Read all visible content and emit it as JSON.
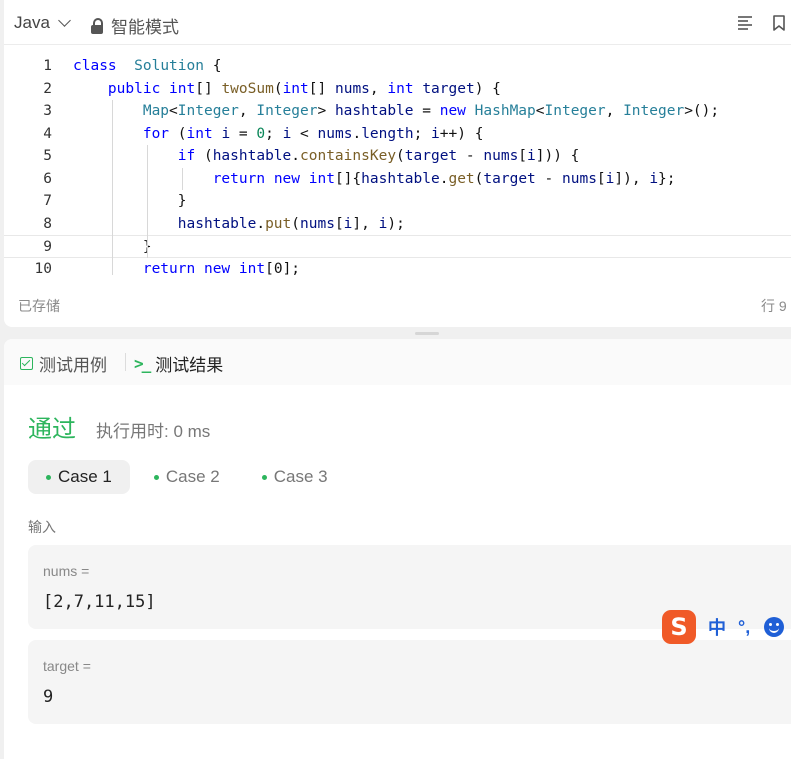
{
  "editor": {
    "language": "Java",
    "mode": "智能模式",
    "status_saved": "已存储",
    "status_position": "行 9",
    "icons": [
      "format-icon",
      "bookmark-icon"
    ],
    "code_lines": [
      {
        "num": "1",
        "tokens": [
          [
            "kw",
            "class"
          ],
          [
            "",
            "  "
          ],
          [
            "ty",
            "Solution"
          ],
          [
            "",
            " {"
          ]
        ]
      },
      {
        "num": "2",
        "tokens": [
          [
            "",
            "    "
          ],
          [
            "kw",
            "public"
          ],
          [
            "",
            " "
          ],
          [
            "kw",
            "int"
          ],
          [
            "",
            "[] "
          ],
          [
            "fn",
            "twoSum"
          ],
          [
            "",
            "("
          ],
          [
            "kw",
            "int"
          ],
          [
            "",
            "[] "
          ],
          [
            "vr",
            "nums"
          ],
          [
            "",
            ", "
          ],
          [
            "kw",
            "int"
          ],
          [
            "",
            " "
          ],
          [
            "vr",
            "target"
          ],
          [
            "",
            ") {"
          ]
        ]
      },
      {
        "num": "3",
        "tokens": [
          [
            "",
            "        "
          ],
          [
            "ty",
            "Map"
          ],
          [
            "",
            "<"
          ],
          [
            "ty",
            "Integer"
          ],
          [
            "",
            ", "
          ],
          [
            "ty",
            "Integer"
          ],
          [
            "",
            "> "
          ],
          [
            "vr",
            "hashtable"
          ],
          [
            "",
            " = "
          ],
          [
            "kw",
            "new"
          ],
          [
            "",
            " "
          ],
          [
            "ty",
            "HashMap"
          ],
          [
            "",
            "<"
          ],
          [
            "ty",
            "Integer"
          ],
          [
            "",
            ", "
          ],
          [
            "ty",
            "Integer"
          ],
          [
            "",
            ">();"
          ]
        ]
      },
      {
        "num": "4",
        "tokens": [
          [
            "",
            "        "
          ],
          [
            "kw",
            "for"
          ],
          [
            "",
            " ("
          ],
          [
            "kw",
            "int"
          ],
          [
            "",
            " "
          ],
          [
            "vr",
            "i"
          ],
          [
            "",
            " = "
          ],
          [
            "nm",
            "0"
          ],
          [
            "",
            "; "
          ],
          [
            "vr",
            "i"
          ],
          [
            "",
            " < "
          ],
          [
            "vr",
            "nums"
          ],
          [
            "",
            "."
          ],
          [
            "vr",
            "length"
          ],
          [
            "",
            "; "
          ],
          [
            "vr",
            "i"
          ],
          [
            "",
            "++) {"
          ]
        ]
      },
      {
        "num": "5",
        "tokens": [
          [
            "",
            "            "
          ],
          [
            "kw",
            "if"
          ],
          [
            "",
            " ("
          ],
          [
            "vr",
            "hashtable"
          ],
          [
            "",
            "."
          ],
          [
            "fn",
            "containsKey"
          ],
          [
            "",
            "("
          ],
          [
            "vr",
            "target"
          ],
          [
            "",
            " - "
          ],
          [
            "vr",
            "nums"
          ],
          [
            "",
            "["
          ],
          [
            "vr",
            "i"
          ],
          [
            "",
            "])) {"
          ]
        ]
      },
      {
        "num": "6",
        "tokens": [
          [
            "",
            "                "
          ],
          [
            "kw",
            "return"
          ],
          [
            "",
            " "
          ],
          [
            "kw",
            "new"
          ],
          [
            "",
            " "
          ],
          [
            "kw",
            "int"
          ],
          [
            "",
            "[]{"
          ],
          [
            "vr",
            "hashtable"
          ],
          [
            "",
            "."
          ],
          [
            "fn",
            "get"
          ],
          [
            "",
            "("
          ],
          [
            "vr",
            "target"
          ],
          [
            "",
            " - "
          ],
          [
            "vr",
            "nums"
          ],
          [
            "",
            "["
          ],
          [
            "vr",
            "i"
          ],
          [
            "",
            "]), "
          ],
          [
            "vr",
            "i"
          ],
          [
            "",
            "};"
          ]
        ]
      },
      {
        "num": "7",
        "tokens": [
          [
            "",
            "            }"
          ]
        ]
      },
      {
        "num": "8",
        "tokens": [
          [
            "",
            "            "
          ],
          [
            "vr",
            "hashtable"
          ],
          [
            "",
            "."
          ],
          [
            "fn",
            "put"
          ],
          [
            "",
            "("
          ],
          [
            "vr",
            "nums"
          ],
          [
            "",
            "["
          ],
          [
            "vr",
            "i"
          ],
          [
            "",
            "], "
          ],
          [
            "vr",
            "i"
          ],
          [
            "",
            ");"
          ]
        ]
      },
      {
        "num": "9",
        "tokens": [
          [
            "",
            "        }"
          ]
        ]
      },
      {
        "num": "10",
        "tokens": [
          [
            "",
            "        "
          ],
          [
            "kw",
            "return"
          ],
          [
            "",
            " "
          ],
          [
            "kw",
            "new"
          ],
          [
            "",
            " "
          ],
          [
            "kw",
            "int"
          ],
          [
            "",
            "[0];"
          ]
        ]
      }
    ],
    "active_line": 9
  },
  "results": {
    "tab_testcase": "测试用例",
    "tab_result": "测试结果",
    "status": "通过",
    "runtime": "执行用时: 0 ms",
    "cases": [
      "Case 1",
      "Case 2",
      "Case 3"
    ],
    "active_case": 0,
    "input_label": "输入",
    "params": [
      {
        "name": "nums =",
        "value": "[2,7,11,15]"
      },
      {
        "name": "target =",
        "value": "9"
      }
    ],
    "colors": {
      "accent": "#2db55d"
    }
  },
  "ime": {
    "logo": "S",
    "lang": "中",
    "punct": "°,",
    "emoji_icon": "smiley-icon"
  }
}
